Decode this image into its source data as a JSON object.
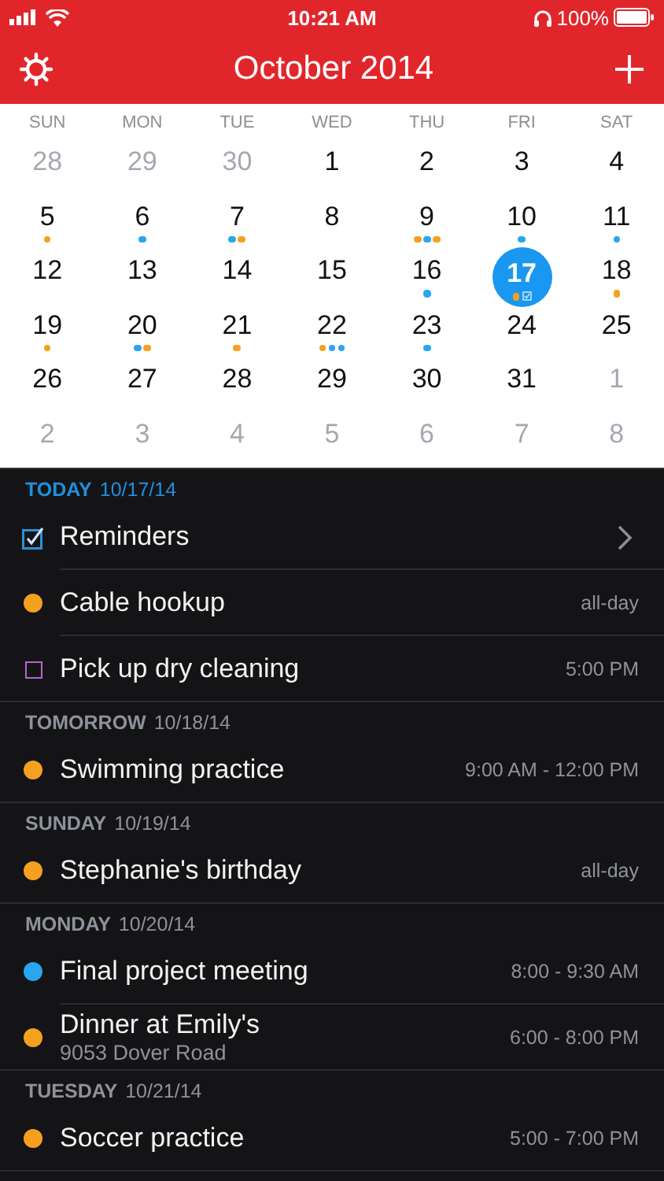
{
  "status_bar": {
    "time": "10:21 AM",
    "battery": "100%"
  },
  "header": {
    "title": "October 2014"
  },
  "weekdays": [
    "SUN",
    "MON",
    "TUE",
    "WED",
    "THU",
    "FRI",
    "SAT"
  ],
  "days": [
    {
      "label": "28",
      "outside": true,
      "selected": false
    },
    {
      "label": "29",
      "outside": true,
      "selected": false
    },
    {
      "label": "30",
      "outside": true,
      "selected": false
    },
    {
      "label": "1",
      "outside": false,
      "selected": false
    },
    {
      "label": "2",
      "outside": false,
      "selected": false
    },
    {
      "label": "3",
      "outside": false,
      "selected": false
    },
    {
      "label": "4",
      "outside": false,
      "selected": false
    },
    {
      "label": "5",
      "outside": false,
      "selected": false,
      "marks": [
        {
          "kind": "dot",
          "color": "#f5a01e"
        }
      ]
    },
    {
      "label": "6",
      "outside": false,
      "selected": false,
      "marks": [
        {
          "kind": "dot",
          "color": "#2aa6ee"
        }
      ]
    },
    {
      "label": "7",
      "outside": false,
      "selected": false,
      "marks": [
        {
          "kind": "dot",
          "color": "#2aa6ee"
        },
        {
          "kind": "dot",
          "color": "#f5a01e"
        }
      ]
    },
    {
      "label": "8",
      "outside": false,
      "selected": false
    },
    {
      "label": "9",
      "outside": false,
      "selected": false,
      "marks": [
        {
          "kind": "dot",
          "color": "#f5a01e"
        },
        {
          "kind": "dot",
          "color": "#2aa6ee"
        },
        {
          "kind": "dot",
          "color": "#f5a01e"
        }
      ]
    },
    {
      "label": "10",
      "outside": false,
      "selected": false,
      "marks": [
        {
          "kind": "dot",
          "color": "#2aa6ee"
        }
      ]
    },
    {
      "label": "11",
      "outside": false,
      "selected": false,
      "marks": [
        {
          "kind": "dot",
          "color": "#2aa6ee"
        }
      ]
    },
    {
      "label": "12",
      "outside": false,
      "selected": false
    },
    {
      "label": "13",
      "outside": false,
      "selected": false
    },
    {
      "label": "14",
      "outside": false,
      "selected": false
    },
    {
      "label": "15",
      "outside": false,
      "selected": false
    },
    {
      "label": "16",
      "outside": false,
      "selected": false,
      "marks": [
        {
          "kind": "dot",
          "color": "#2aa6ee"
        }
      ]
    },
    {
      "label": "17",
      "outside": false,
      "selected": true,
      "marks": [
        {
          "kind": "dot",
          "color": "#f5a01e"
        },
        {
          "kind": "reminder"
        }
      ]
    },
    {
      "label": "18",
      "outside": false,
      "selected": false,
      "marks": [
        {
          "kind": "dot",
          "color": "#f5a01e"
        }
      ]
    },
    {
      "label": "19",
      "outside": false,
      "selected": false,
      "marks": [
        {
          "kind": "dot",
          "color": "#f5a01e"
        }
      ]
    },
    {
      "label": "20",
      "outside": false,
      "selected": false,
      "marks": [
        {
          "kind": "dot",
          "color": "#2aa6ee"
        },
        {
          "kind": "dot",
          "color": "#f5a01e"
        }
      ]
    },
    {
      "label": "21",
      "outside": false,
      "selected": false,
      "marks": [
        {
          "kind": "dot",
          "color": "#f5a01e"
        }
      ]
    },
    {
      "label": "22",
      "outside": false,
      "selected": false,
      "marks": [
        {
          "kind": "dot",
          "color": "#f5a01e"
        },
        {
          "kind": "dot",
          "color": "#2aa6ee"
        },
        {
          "kind": "dot",
          "color": "#2aa6ee"
        }
      ]
    },
    {
      "label": "23",
      "outside": false,
      "selected": false,
      "marks": [
        {
          "kind": "dot",
          "color": "#2aa6ee"
        }
      ]
    },
    {
      "label": "24",
      "outside": false,
      "selected": false
    },
    {
      "label": "25",
      "outside": false,
      "selected": false
    },
    {
      "label": "26",
      "outside": false,
      "selected": false
    },
    {
      "label": "27",
      "outside": false,
      "selected": false
    },
    {
      "label": "28",
      "outside": false,
      "selected": false
    },
    {
      "label": "29",
      "outside": false,
      "selected": false
    },
    {
      "label": "30",
      "outside": false,
      "selected": false
    },
    {
      "label": "31",
      "outside": false,
      "selected": false
    },
    {
      "label": "1",
      "outside": true,
      "selected": false
    },
    {
      "label": "2",
      "outside": true,
      "selected": false
    },
    {
      "label": "3",
      "outside": true,
      "selected": false
    },
    {
      "label": "4",
      "outside": true,
      "selected": false
    },
    {
      "label": "5",
      "outside": true,
      "selected": false
    },
    {
      "label": "6",
      "outside": true,
      "selected": false
    },
    {
      "label": "7",
      "outside": true,
      "selected": false
    },
    {
      "label": "8",
      "outside": true,
      "selected": false
    }
  ],
  "agenda": [
    {
      "day": "TODAY",
      "date": "10/17/14",
      "today": true,
      "items": [
        {
          "kind": "reminders",
          "title": "Reminders",
          "checked": true
        },
        {
          "kind": "event",
          "title": "Cable hookup",
          "time": "all-day",
          "color": "#f5a01e"
        },
        {
          "kind": "task",
          "title": "Pick up dry cleaning",
          "time": "5:00 PM",
          "color": "#b565c9"
        }
      ]
    },
    {
      "day": "TOMORROW",
      "date": "10/18/14",
      "today": false,
      "items": [
        {
          "kind": "event",
          "title": "Swimming practice",
          "time": "9:00 AM - 12:00 PM",
          "color": "#f5a01e"
        }
      ]
    },
    {
      "day": "SUNDAY",
      "date": "10/19/14",
      "today": false,
      "items": [
        {
          "kind": "event",
          "title": "Stephanie's birthday",
          "time": "all-day",
          "color": "#f5a01e"
        }
      ]
    },
    {
      "day": "MONDAY",
      "date": "10/20/14",
      "today": false,
      "items": [
        {
          "kind": "event",
          "title": "Final project meeting",
          "time": "8:00 - 9:30 AM",
          "color": "#2aa6ee"
        },
        {
          "kind": "event",
          "title": "Dinner at Emily's",
          "subtitle": "9053 Dover Road",
          "time": "6:00 - 8:00 PM",
          "color": "#f5a01e"
        }
      ]
    },
    {
      "day": "TUESDAY",
      "date": "10/21/14",
      "today": false,
      "items": [
        {
          "kind": "event",
          "title": "Soccer practice",
          "time": "5:00 - 7:00 PM",
          "color": "#f5a01e"
        }
      ]
    }
  ]
}
